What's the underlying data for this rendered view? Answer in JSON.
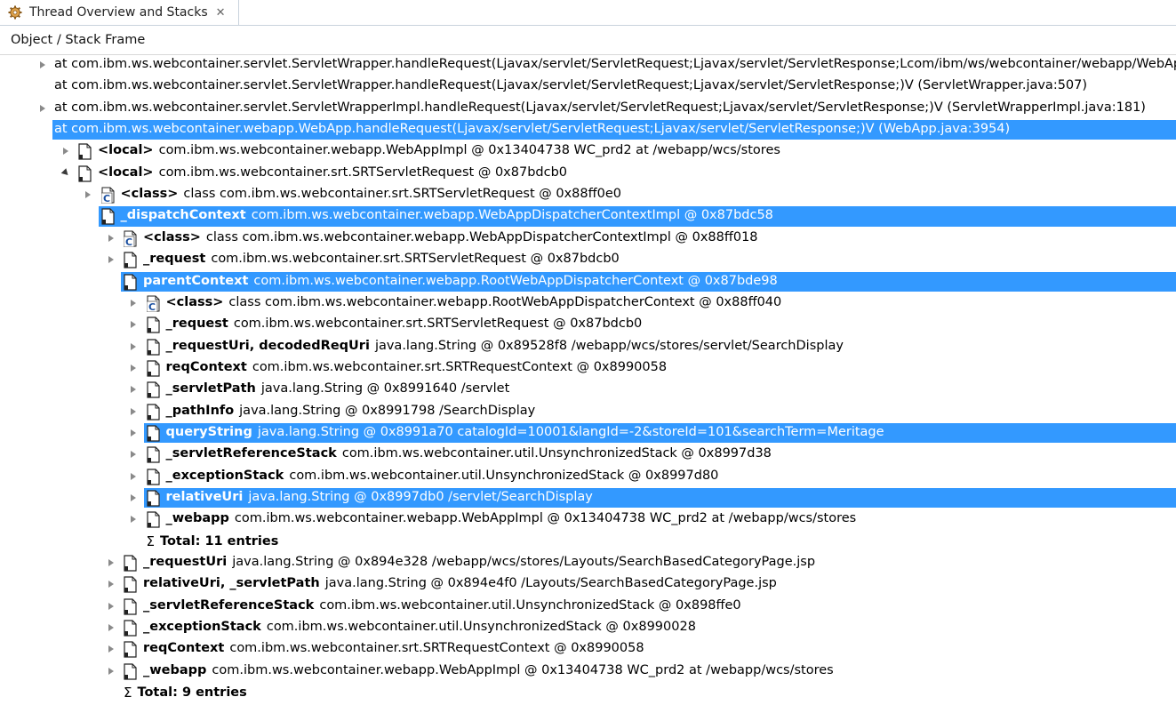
{
  "tab": {
    "title": "Thread Overview and Stacks",
    "icon": "thread-gear-icon",
    "close_icon": "close-icon"
  },
  "column_header": "Object / Stack Frame",
  "colors": {
    "selection": "#3399ff"
  },
  "rows": [
    {
      "indent": 0,
      "twist": "collapsed",
      "icon": "",
      "name": "",
      "value": "at com.ibm.ws.webcontainer.servlet.ServletWrapper.handleRequest(Ljavax/servlet/ServletRequest;Ljavax/servlet/ServletResponse;Lcom/ibm/ws/webcontainer/webapp/WebAppD",
      "selected": false
    },
    {
      "indent": 0,
      "twist": "none",
      "icon": "",
      "name": "",
      "value": "at com.ibm.ws.webcontainer.servlet.ServletWrapper.handleRequest(Ljavax/servlet/ServletRequest;Ljavax/servlet/ServletResponse;)V (ServletWrapper.java:507)",
      "selected": false
    },
    {
      "indent": 0,
      "twist": "collapsed",
      "icon": "",
      "name": "",
      "value": "at com.ibm.ws.webcontainer.servlet.ServletWrapperImpl.handleRequest(Ljavax/servlet/ServletRequest;Ljavax/servlet/ServletResponse;)V (ServletWrapperImpl.java:181)",
      "selected": false
    },
    {
      "indent": 0,
      "twist": "expanded",
      "icon": "",
      "name": "",
      "value": "at com.ibm.ws.webcontainer.webapp.WebApp.handleRequest(Ljavax/servlet/ServletRequest;Ljavax/servlet/ServletResponse;)V (WebApp.java:3954)",
      "selected": true
    },
    {
      "indent": 1,
      "twist": "collapsed",
      "icon": "object-icon",
      "name": "<local>",
      "value": "com.ibm.ws.webcontainer.webapp.WebAppImpl @ 0x13404738  WC_prd2 at /webapp/wcs/stores",
      "selected": false
    },
    {
      "indent": 1,
      "twist": "expanded",
      "icon": "object-icon",
      "name": "<local>",
      "value": "com.ibm.ws.webcontainer.srt.SRTServletRequest @ 0x87bdcb0",
      "selected": false
    },
    {
      "indent": 2,
      "twist": "collapsed",
      "icon": "class-icon",
      "name": "<class>",
      "value": "class com.ibm.ws.webcontainer.srt.SRTServletRequest @ 0x88ff0e0",
      "selected": false
    },
    {
      "indent": 2,
      "twist": "expanded",
      "icon": "field-icon",
      "name": "_dispatchContext",
      "value": "com.ibm.ws.webcontainer.webapp.WebAppDispatcherContextImpl @ 0x87bdc58",
      "selected": true
    },
    {
      "indent": 3,
      "twist": "collapsed",
      "icon": "class-icon",
      "name": "<class>",
      "value": "class com.ibm.ws.webcontainer.webapp.WebAppDispatcherContextImpl @ 0x88ff018",
      "selected": false
    },
    {
      "indent": 3,
      "twist": "collapsed",
      "icon": "field-icon",
      "name": "_request",
      "value": "com.ibm.ws.webcontainer.srt.SRTServletRequest @ 0x87bdcb0",
      "selected": false
    },
    {
      "indent": 3,
      "twist": "expanded",
      "icon": "field-icon",
      "name": "parentContext",
      "value": "com.ibm.ws.webcontainer.webapp.RootWebAppDispatcherContext @ 0x87bde98",
      "selected": true
    },
    {
      "indent": 4,
      "twist": "collapsed",
      "icon": "class-icon",
      "name": "<class>",
      "value": "class com.ibm.ws.webcontainer.webapp.RootWebAppDispatcherContext @ 0x88ff040",
      "selected": false
    },
    {
      "indent": 4,
      "twist": "collapsed",
      "icon": "field-icon",
      "name": "_request",
      "value": "com.ibm.ws.webcontainer.srt.SRTServletRequest @ 0x87bdcb0",
      "selected": false
    },
    {
      "indent": 4,
      "twist": "collapsed",
      "icon": "field-icon",
      "name": "_requestUri, decodedReqUri",
      "value": "java.lang.String @ 0x89528f8  /webapp/wcs/stores/servlet/SearchDisplay",
      "selected": false
    },
    {
      "indent": 4,
      "twist": "collapsed",
      "icon": "field-icon",
      "name": "reqContext",
      "value": "com.ibm.ws.webcontainer.srt.SRTRequestContext @ 0x8990058",
      "selected": false
    },
    {
      "indent": 4,
      "twist": "collapsed",
      "icon": "field-icon",
      "name": "_servletPath",
      "value": "java.lang.String @ 0x8991640  /servlet",
      "selected": false
    },
    {
      "indent": 4,
      "twist": "collapsed",
      "icon": "field-icon",
      "name": "_pathInfo",
      "value": "java.lang.String @ 0x8991798  /SearchDisplay",
      "selected": false
    },
    {
      "indent": 4,
      "twist": "collapsed",
      "icon": "field-icon",
      "name": "queryString",
      "value": "java.lang.String @ 0x8991a70  catalogId=10001&langId=-2&storeId=101&searchTerm=Meritage",
      "selected": true
    },
    {
      "indent": 4,
      "twist": "collapsed",
      "icon": "field-icon",
      "name": "_servletReferenceStack",
      "value": "com.ibm.ws.webcontainer.util.UnsynchronizedStack @ 0x8997d38",
      "selected": false
    },
    {
      "indent": 4,
      "twist": "collapsed",
      "icon": "field-icon",
      "name": "_exceptionStack",
      "value": "com.ibm.ws.webcontainer.util.UnsynchronizedStack @ 0x8997d80",
      "selected": false
    },
    {
      "indent": 4,
      "twist": "collapsed",
      "icon": "field-icon",
      "name": "relativeUri",
      "value": "java.lang.String @ 0x8997db0  /servlet/SearchDisplay",
      "selected": true
    },
    {
      "indent": 4,
      "twist": "collapsed",
      "icon": "field-icon",
      "name": "_webapp",
      "value": "com.ibm.ws.webcontainer.webapp.WebAppImpl @ 0x13404738  WC_prd2 at /webapp/wcs/stores",
      "selected": false
    },
    {
      "indent": 4,
      "twist": "none",
      "icon": "sigma",
      "name": "Total: 11 entries",
      "value": "",
      "selected": false
    },
    {
      "indent": 3,
      "twist": "collapsed",
      "icon": "field-icon",
      "name": "_requestUri",
      "value": "java.lang.String @ 0x894e328  /webapp/wcs/stores/Layouts/SearchBasedCategoryPage.jsp",
      "selected": false
    },
    {
      "indent": 3,
      "twist": "collapsed",
      "icon": "field-icon",
      "name": "relativeUri, _servletPath",
      "value": "java.lang.String @ 0x894e4f0  /Layouts/SearchBasedCategoryPage.jsp",
      "selected": false
    },
    {
      "indent": 3,
      "twist": "collapsed",
      "icon": "field-icon",
      "name": "_servletReferenceStack",
      "value": "com.ibm.ws.webcontainer.util.UnsynchronizedStack @ 0x898ffe0",
      "selected": false
    },
    {
      "indent": 3,
      "twist": "collapsed",
      "icon": "field-icon",
      "name": "_exceptionStack",
      "value": "com.ibm.ws.webcontainer.util.UnsynchronizedStack @ 0x8990028",
      "selected": false
    },
    {
      "indent": 3,
      "twist": "collapsed",
      "icon": "field-icon",
      "name": "reqContext",
      "value": "com.ibm.ws.webcontainer.srt.SRTRequestContext @ 0x8990058",
      "selected": false
    },
    {
      "indent": 3,
      "twist": "collapsed",
      "icon": "field-icon",
      "name": "_webapp",
      "value": "com.ibm.ws.webcontainer.webapp.WebAppImpl @ 0x13404738  WC_prd2 at /webapp/wcs/stores",
      "selected": false
    },
    {
      "indent": 3,
      "twist": "none",
      "icon": "sigma",
      "name": "Total: 9 entries",
      "value": "",
      "selected": false
    }
  ]
}
